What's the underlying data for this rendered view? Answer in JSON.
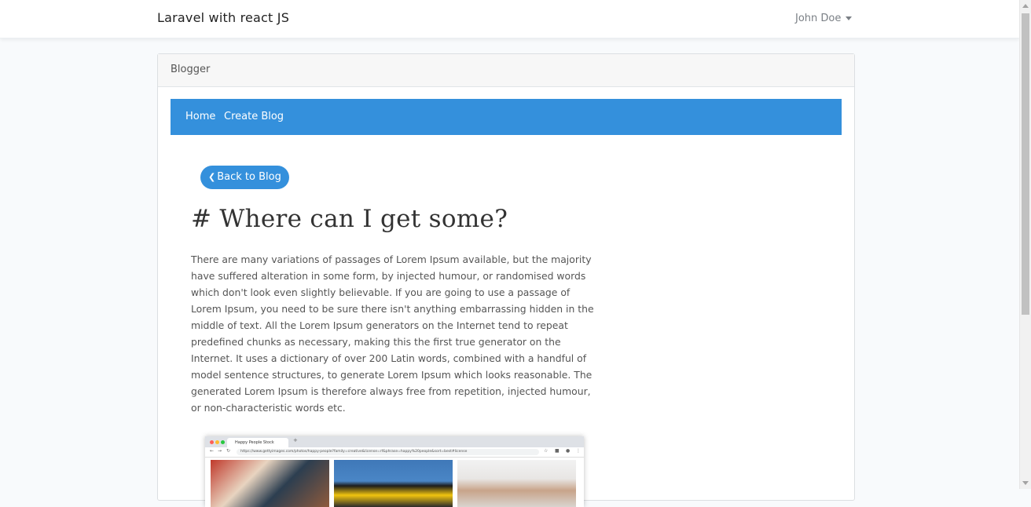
{
  "navbar": {
    "brand": "Laravel with react JS",
    "user": "John Doe"
  },
  "card": {
    "header": "Blogger"
  },
  "blog_nav": {
    "home": "Home",
    "create": "Create Blog"
  },
  "post": {
    "back_label": "Back to Blog",
    "title": "# Where can I get some?",
    "body": "There are many variations of passages of Lorem Ipsum available, but the majority have suffered alteration in some form, by injected humour, or randomised words which don't look even slightly believable. If you are going to use a passage of Lorem Ipsum, you need to be sure there isn't anything embarrassing hidden in the middle of text. All the Lorem Ipsum generators on the Internet tend to repeat predefined chunks as necessary, making this the first true generator on the Internet. It uses a dictionary of over 200 Latin words, combined with a handful of model sentence structures, to generate Lorem Ipsum which looks reasonable. The generated Lorem Ipsum is therefore always free from repetition, injected humour, or non-characteristic words etc."
  },
  "embedded_image": {
    "tab_title": "Happy People Stock Photos",
    "url": "https://www.gettyimages.com/photos/happy-people?family=creative&license=rf&phrase=happy%20people&sort=best#license"
  },
  "colors": {
    "accent": "#3490dc",
    "page_bg": "#f8fafc"
  }
}
